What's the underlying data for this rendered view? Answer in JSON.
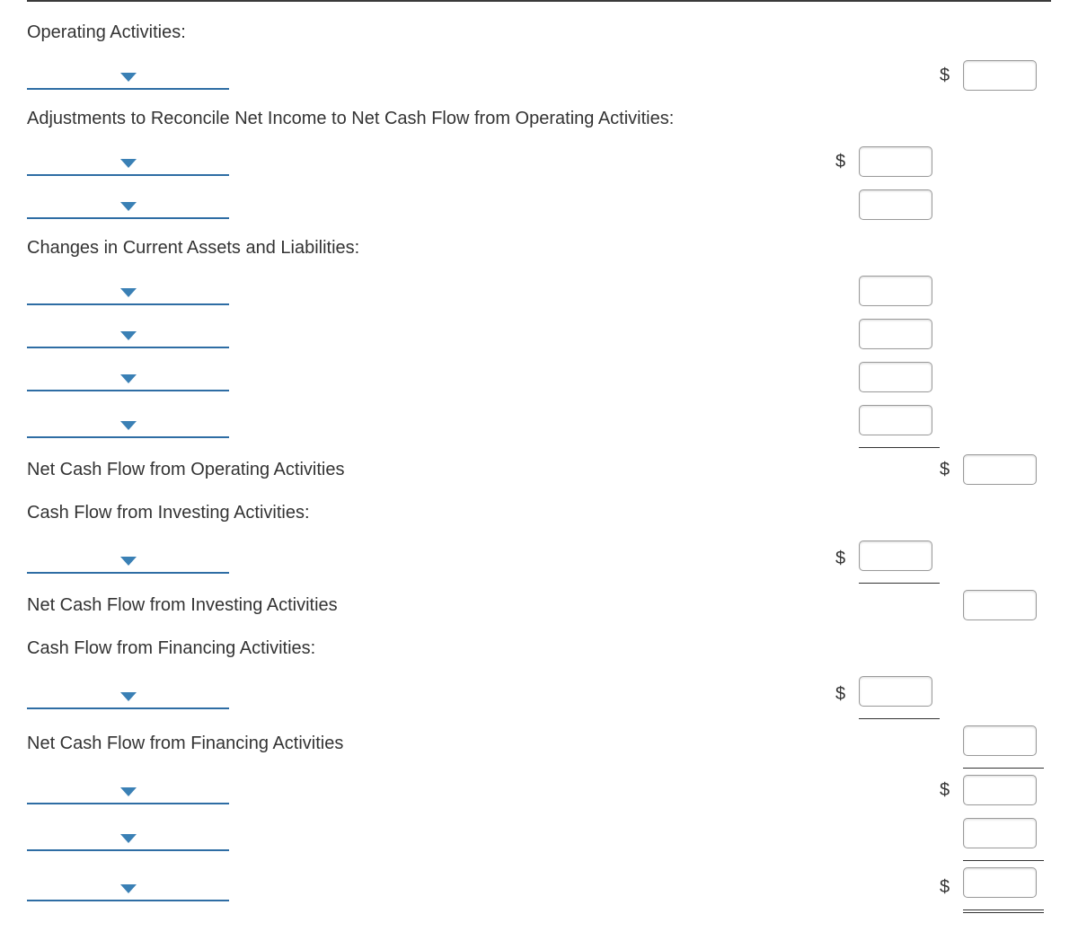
{
  "currency_symbol": "$",
  "sections": {
    "operating_header": "Operating Activities:",
    "adjustments_header": "Adjustments to Reconcile Net Income to Net Cash Flow from Operating Activities:",
    "changes_header": "Changes in Current Assets and Liabilities:",
    "net_operating": "Net Cash Flow from Operating Activities",
    "investing_header": "Cash Flow from Investing Activities:",
    "net_investing": "Net Cash Flow from Investing Activities",
    "financing_header": "Cash Flow from Financing Activities:",
    "net_financing": "Net Cash Flow from Financing Activities"
  },
  "dropdowns": {
    "operating_item": "",
    "adjustment_1": "",
    "adjustment_2": "",
    "change_1": "",
    "change_2": "",
    "change_3": "",
    "change_4": "",
    "investing_item": "",
    "financing_item": "",
    "summary_1": "",
    "summary_2": "",
    "summary_3": ""
  },
  "amounts": {
    "operating_item_total": "",
    "adjustment_1": "",
    "adjustment_2": "",
    "change_1": "",
    "change_2": "",
    "change_3": "",
    "change_4": "",
    "net_operating_total": "",
    "investing_item": "",
    "net_investing_total": "",
    "financing_item": "",
    "net_financing_total": "",
    "summary_1_total": "",
    "summary_2_total": "",
    "summary_3_total": ""
  }
}
